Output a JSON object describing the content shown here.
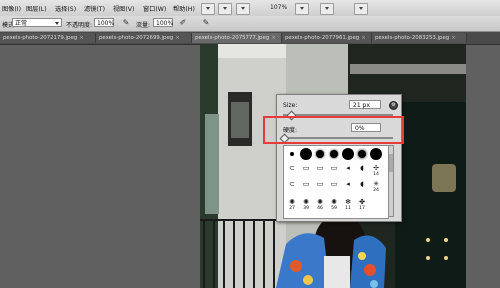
{
  "menubar": {
    "items": [
      "图像(I)",
      "图层(L)",
      "选择(S)",
      "滤镜(T)",
      "视图(V)",
      "窗口(W)",
      "帮助(H)"
    ],
    "zoom": "107%"
  },
  "options": {
    "mode_value": "正常",
    "opacity_label": "不透明度:",
    "opacity_value": "100%",
    "flow_label": "流量:",
    "flow_value": "100%"
  },
  "tabs": [
    "pexels-photo-2072179.jpeg",
    "pexels-photo-2072699.jpeg",
    "pexels-photo-2075777.jpeg",
    "pexels-photo-2077961.jpeg",
    "pexels-photo-2083253.jpeg"
  ],
  "brush_popup": {
    "size_label": "Size:",
    "size_value": "21 px",
    "hardness_label": "硬度:",
    "hardness_value": "0%",
    "brush_numbers": [
      "27",
      "39",
      "46",
      "59",
      "11",
      "17"
    ],
    "side_numbers": [
      "14",
      "24"
    ]
  },
  "colors": {
    "highlight": "#e53b3b"
  }
}
